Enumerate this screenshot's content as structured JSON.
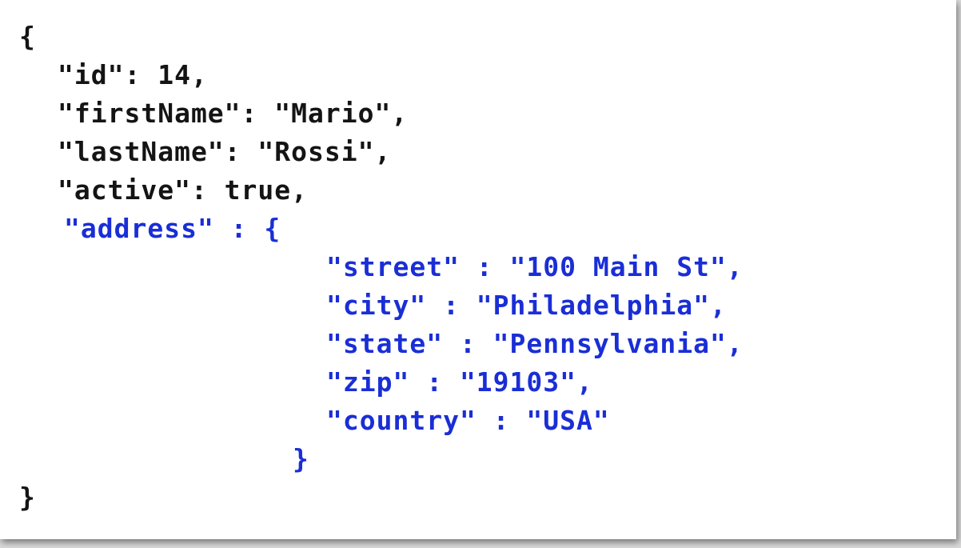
{
  "document": {
    "lines": [
      "{",
      "\"id\": 14,",
      "\"firstName\": \"Mario\",",
      "\"lastName\": \"Rossi\",",
      "\"active\": true,",
      "\"address\" : {",
      "\"street\" : \"100 Main St\",",
      "\"city\" : \"Philadelphia\",",
      "\"state\" : \"Pennsylvania\",",
      "\"zip\" : \"19103\",",
      "\"country\" : \"USA\"",
      "}",
      "}"
    ]
  },
  "colors": {
    "text_default": "#141414",
    "text_address": "#1a2ed6",
    "background": "#ffffff"
  }
}
